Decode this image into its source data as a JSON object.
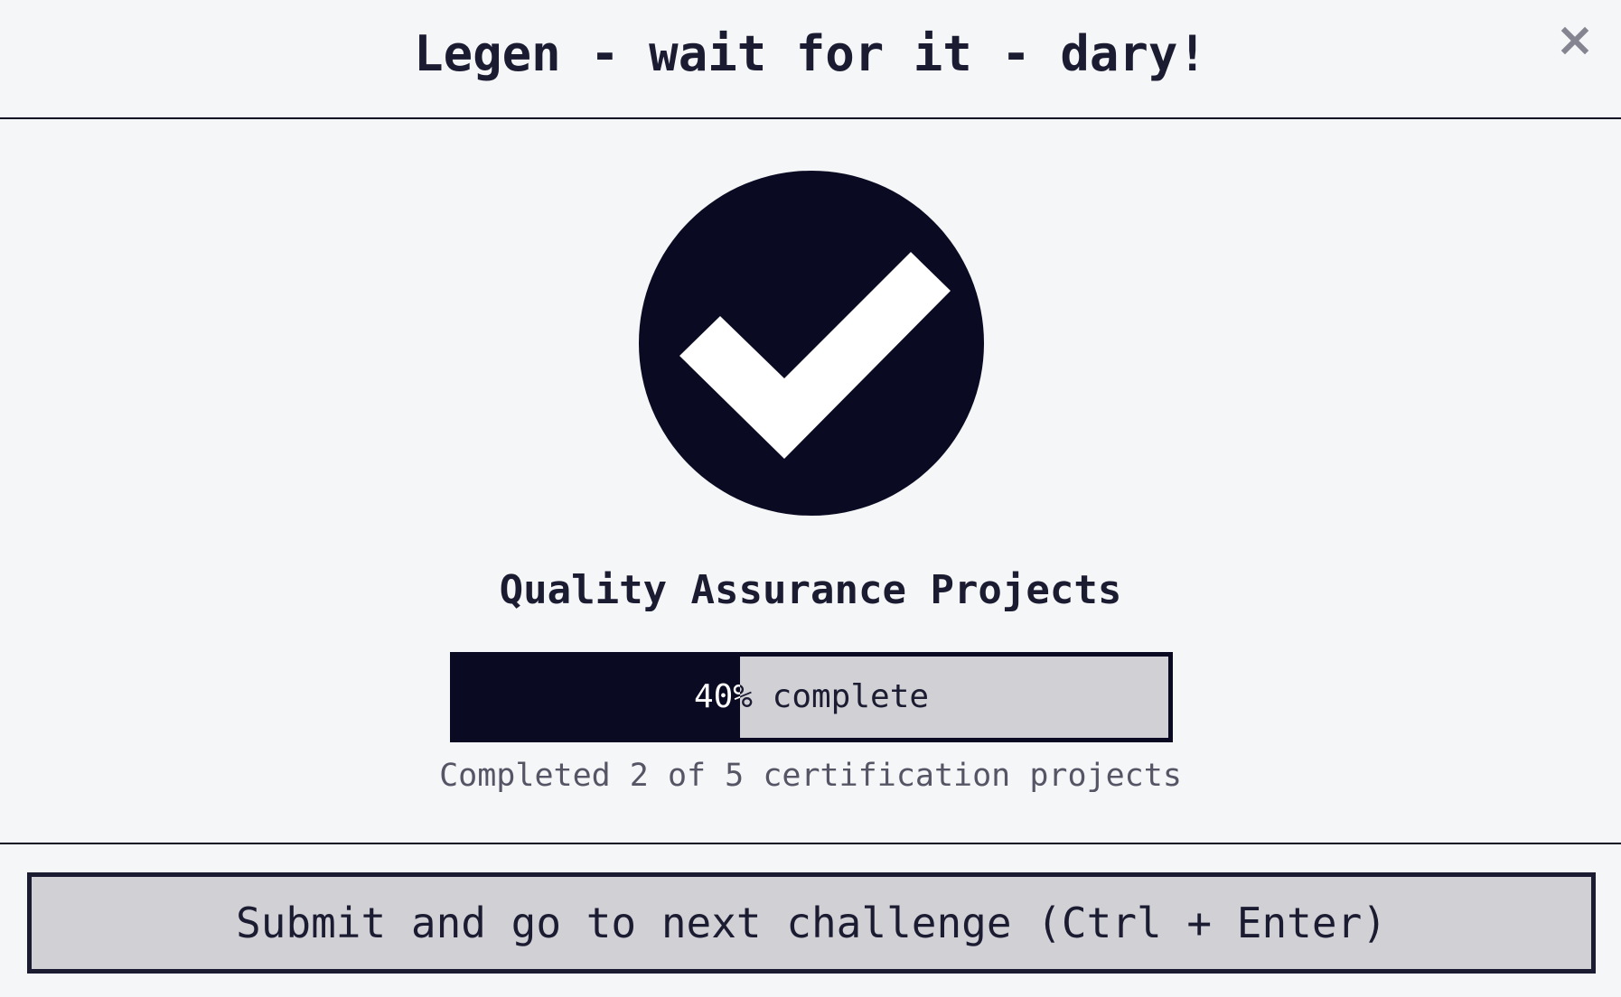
{
  "modal": {
    "title": "Legen - wait for it - dary!",
    "close_label": "×"
  },
  "completion": {
    "block_title": "Quality Assurance Projects",
    "progress_percent": 40,
    "progress_label": "40% complete",
    "progress_summary": "Completed 2 of 5 certification projects"
  },
  "footer": {
    "submit_label": "Submit and go to next challenge (Ctrl + Enter)"
  },
  "icons": {
    "check": "check-circle-icon",
    "close": "close-icon"
  },
  "colors": {
    "dark": "#0a0a23",
    "text": "#1b1b32",
    "bar_bg": "#d0d0d5",
    "background": "#f5f6f7",
    "close": "#858591"
  }
}
